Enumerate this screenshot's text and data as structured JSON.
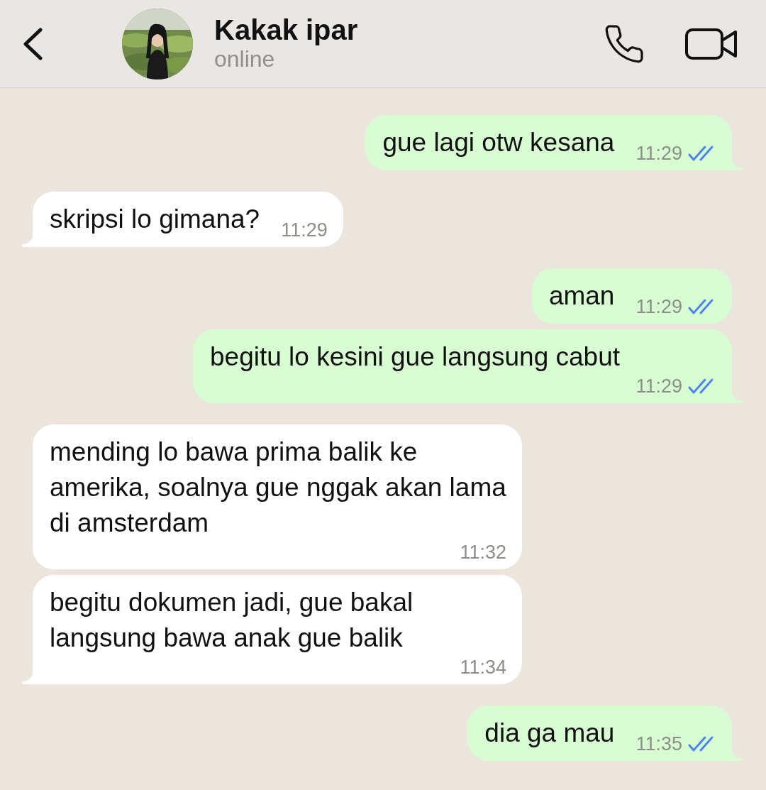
{
  "header": {
    "contact": {
      "name": "Kakak ipar",
      "status": "online"
    }
  },
  "messages": [
    {
      "kind": "sent",
      "text": "gue lagi otw kesana",
      "time": "11:29",
      "read": true,
      "tail": true
    },
    {
      "kind": "received",
      "text": "skripsi lo gimana?",
      "time": "11:29",
      "tail": true
    },
    {
      "kind": "sent",
      "text": "aman",
      "time": "11:29",
      "read": true,
      "tail": false
    },
    {
      "kind": "sent",
      "text": "begitu lo kesini gue langsung cabut",
      "time": "11:29",
      "read": true,
      "tail": true
    },
    {
      "kind": "received",
      "text": "mending lo bawa prima balik ke amerika, soalnya gue nggak akan lama di amsterdam",
      "time": "11:32",
      "tail": false
    },
    {
      "kind": "received",
      "text": "begitu dokumen jadi, gue bakal langsung bawa anak gue balik",
      "time": "11:34",
      "tail": true
    },
    {
      "kind": "sent",
      "text": "dia ga mau",
      "time": "11:35",
      "read": true,
      "tail": true
    }
  ]
}
